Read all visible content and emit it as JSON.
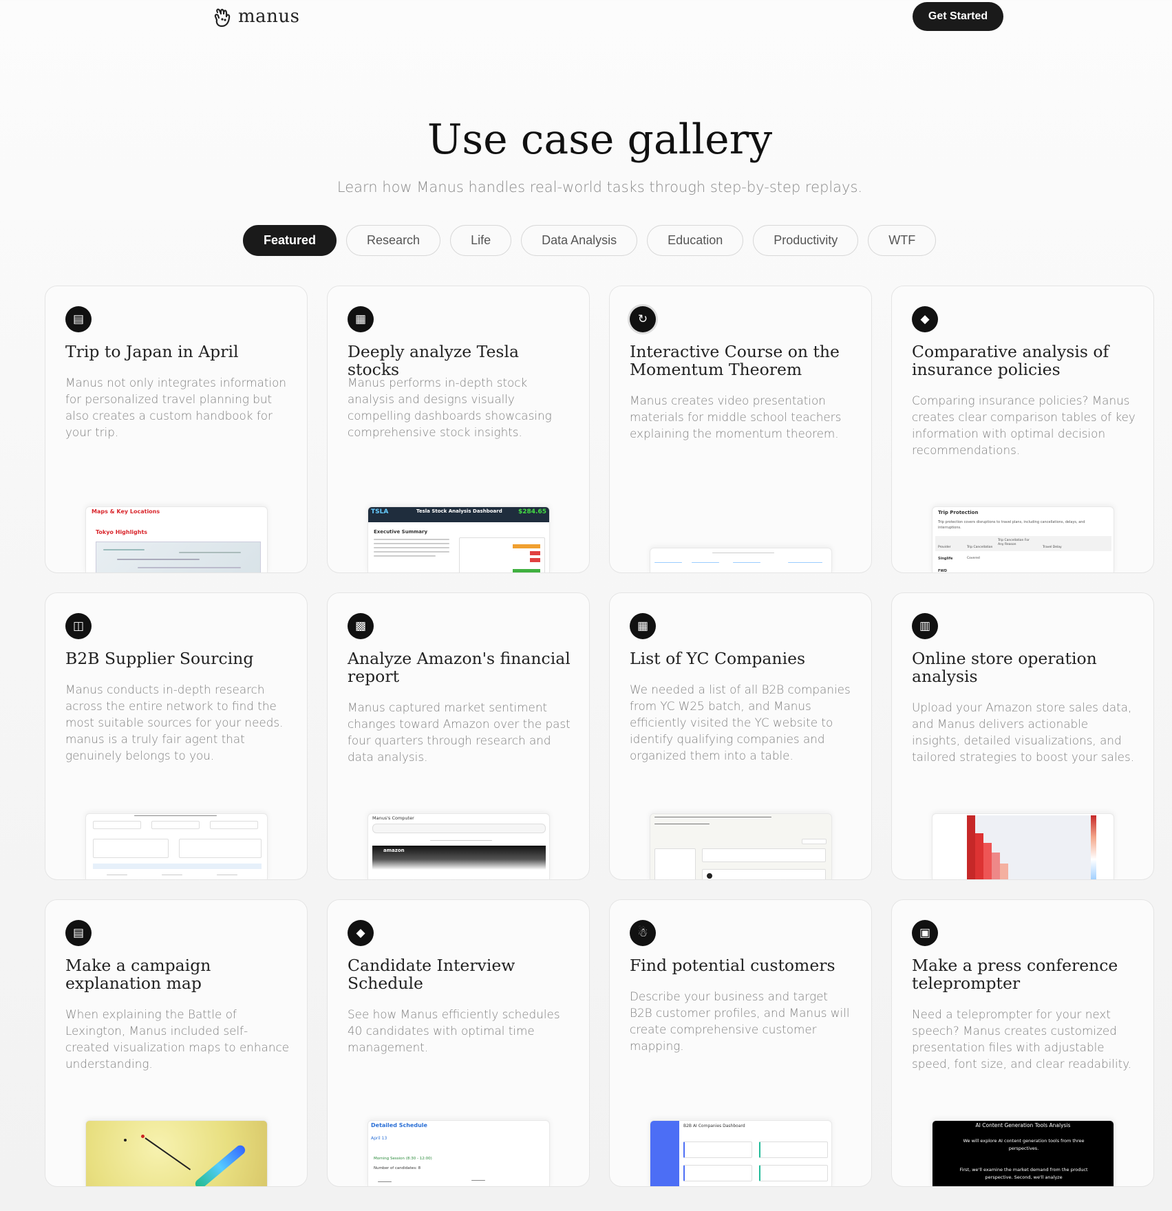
{
  "header": {
    "logo_text": "manus",
    "cta_label": "Get Started"
  },
  "hero": {
    "title": "Use case gallery",
    "subtitle": "Learn how Manus handles real-world tasks through step-by-step replays."
  },
  "tabs": [
    {
      "label": "Featured",
      "active": true
    },
    {
      "label": "Research"
    },
    {
      "label": "Life"
    },
    {
      "label": "Data Analysis"
    },
    {
      "label": "Education"
    },
    {
      "label": "Productivity"
    },
    {
      "label": "WTF"
    }
  ],
  "cards": [
    {
      "title": "Trip to Japan in April",
      "icon": "book-icon",
      "desc": "Manus not only integrates information for personalized travel planning but also creates a custom handbook for your trip.",
      "preview": {
        "label1": "Maps & Key Locations",
        "label2": "Tokyo Highlights"
      }
    },
    {
      "title": "Deeply analyze Tesla stocks",
      "icon": "chart-icon",
      "desc": "Manus performs in-depth stock analysis and designs visually compelling dashboards showcasing comprehensive stock insights.",
      "preview": {
        "ticker": "TSLA",
        "title": "Tesla Stock Analysis Dashboard",
        "price": "$284.65",
        "section": "Executive Summary"
      }
    },
    {
      "title": "Interactive Course on the Momentum Theorem",
      "icon": "refresh-icon",
      "desc": "Manus creates video presentation materials for middle school teachers explaining the momentum theorem."
    },
    {
      "title": "Comparative analysis of insurance policies",
      "icon": "shield-icon",
      "desc": "Comparing insurance policies? Manus creates clear comparison tables of key information with optimal decision recommendations.",
      "preview": {
        "heading": "Trip Protection",
        "text": "Trip protection covers disruptions to travel plans, including cancellations, delays, and interruptions.",
        "col1": "Provider",
        "col2": "Trip Cancellation",
        "col3": "Trip Cancellation For Any Reason",
        "col4": "Travel Delay",
        "row1": "Singlife",
        "row1c": "Covered",
        "row2": "FWD"
      }
    },
    {
      "title": "B2B Supplier Sourcing",
      "icon": "cart-icon",
      "desc": "Manus conducts in-depth research across the entire network to find the most suitable sources for your needs. manus is a truly fair agent that genuinely belongs to you."
    },
    {
      "title": "Analyze Amazon's financial report",
      "icon": "report-icon",
      "desc": "Manus captured market sentiment changes toward Amazon over the past four quarters through research and data analysis.",
      "preview": {
        "window": "Manus's Computer",
        "brand": "amazon"
      }
    },
    {
      "title": "List of YC Companies",
      "icon": "document-icon",
      "desc": "We needed a list of all B2B companies from YC W25 batch, and Manus efficiently visited the YC website to identify qualifying companies and organized them into a table."
    },
    {
      "title": "Online store operation analysis",
      "icon": "bar-chart-icon",
      "desc": "Upload your Amazon store sales data, and Manus delivers actionable insights, detailed visualizations, and tailored strategies to boost your sales."
    },
    {
      "title": "Make a campaign explanation map",
      "icon": "map-icon",
      "desc": "When explaining the Battle of Lexington, Manus included self-created visualization maps to enhance understanding."
    },
    {
      "title": "Candidate Interview Schedule",
      "icon": "compass-icon",
      "desc": "See how Manus efficiently schedules 40 candidates with optimal time management.",
      "preview": {
        "heading": "Detailed Schedule",
        "date": "April 13",
        "session": "Morning Session (8:30 - 12:00)",
        "count": "Number of candidates: 8"
      }
    },
    {
      "title": "Find potential customers",
      "icon": "megaphone-icon",
      "desc": "Describe your business and target B2B customer profiles, and Manus will create comprehensive customer mapping.",
      "preview": {
        "heading": "B2B AI Companies Dashboard"
      }
    },
    {
      "title": "Make a press conference teleprompter",
      "icon": "file-icon",
      "desc": "Need a teleprompter for your next speech? Manus creates customized presentation files with adjustable speed, font size, and clear readability.",
      "preview": {
        "heading": "AI Content Generation Tools Analysis",
        "line1": "We will explore AI content generation tools from three perspectives.",
        "line2": "First, we'll examine the market demand from the product perspective. Second, we'll analyze"
      }
    }
  ]
}
